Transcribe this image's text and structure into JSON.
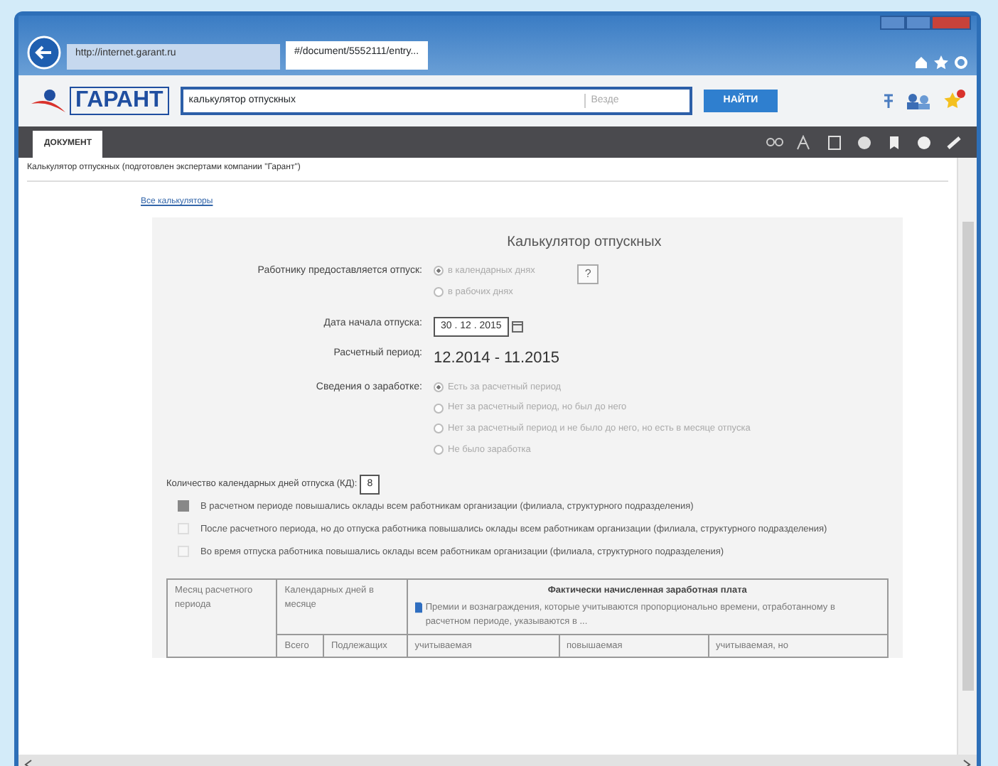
{
  "browser": {
    "address": "http://internet.garant.ru",
    "tabs": [
      {
        "label": "#/document/5552111/entry...",
        "selected": true
      }
    ]
  },
  "toolbar": {
    "logo_text": "ГАРАНТ",
    "search_value": "калькулятор отпускных",
    "scope": "Везде",
    "search_button": "НАЙТИ"
  },
  "doc_tabs": [
    {
      "label": "ДОКУМЕНТ",
      "selected": true
    }
  ],
  "breadcrumb": "Калькулятор отпускных (подготовлен экспертами компании \"Гарант\")",
  "link": "Все калькуляторы",
  "calculator": {
    "title": "Калькулятор отпускных",
    "leave_label": "Работнику предоставляется отпуск:",
    "leave_options": [
      {
        "label": "в календарных днях",
        "selected": true
      },
      {
        "label": "в рабочих днях",
        "selected": false
      }
    ],
    "help": "?",
    "start_label": "Дата начала отпуска:",
    "start_value": "30 . 12 . 2015",
    "period_label": "Расчетный период:",
    "period_value": "12.2014 - 11.2015",
    "earnings_label": "Сведения о заработке:",
    "earnings_options": [
      {
        "label": "Есть за расчетный период",
        "selected": true
      },
      {
        "label": "Нет за расчетный период, но был до него",
        "selected": false
      },
      {
        "label": "Нет за расчетный период и не было до него, но есть в месяце отпуска",
        "selected": false
      },
      {
        "label": "Не было заработка",
        "selected": false
      }
    ],
    "days_label": "Количество календарных дней отпуска (КД):",
    "days_value": "8",
    "checkboxes": [
      {
        "label": "В расчетном периоде повышались оклады всем работникам организации (филиала, структурного подразделения)",
        "checked": true
      },
      {
        "label": "После расчетного периода, но до отпуска работника повышались оклады всем работникам организации (филиала, структурного подразделения)",
        "checked": false
      },
      {
        "label": "Во время отпуска работника повышались оклады всем работникам организации (филиала, структурного подразделения)",
        "checked": false
      }
    ]
  },
  "table": {
    "month_header": "Месяц расчетного периода",
    "days_header": "Календарных дней в месяце",
    "salary_header": "Фактически начисленная заработная плата",
    "salary_note": "Премии и вознаграждения, которые учитываются пропорционально времени, отработанному в расчетном периоде, указываются в ...",
    "sub_headers": [
      "Всего",
      "Подлежащих",
      "учитываемая",
      "повышаемая",
      "учитываемая, но"
    ]
  }
}
